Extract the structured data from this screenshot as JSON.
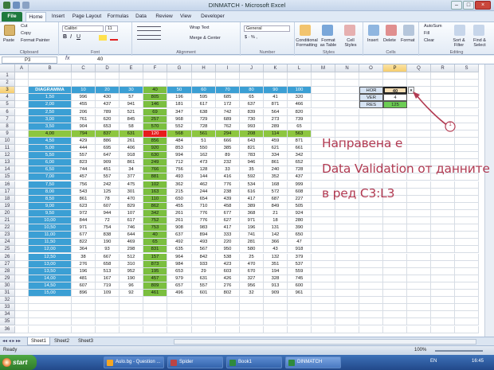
{
  "window": {
    "title": "DINMATCH - Microsoft Excel"
  },
  "tabs": [
    "File",
    "Home",
    "Insert",
    "Page Layout",
    "Formulas",
    "Data",
    "Review",
    "View",
    "Developer"
  ],
  "ribbon": {
    "clipboard": {
      "label": "Clipboard",
      "paste": "Paste",
      "cut": "Cut",
      "copy": "Copy",
      "format_painter": "Format Painter"
    },
    "font": {
      "label": "Font",
      "name": "Calibri",
      "size": "11"
    },
    "alignment": {
      "label": "Alignment",
      "wrap": "Wrap Text",
      "merge": "Merge & Center"
    },
    "number": {
      "label": "Number",
      "format": "General"
    },
    "styles": {
      "label": "Styles",
      "cond": "Conditional Formatting",
      "table": "Format as Table",
      "cell": "Cell Styles"
    },
    "cells": {
      "label": "Cells",
      "insert": "Insert",
      "delete": "Delete",
      "format": "Format"
    },
    "editing": {
      "label": "Editing",
      "autosum": "AutoSum",
      "fill": "Fill",
      "clear": "Clear",
      "sort": "Sort & Filter",
      "find": "Find & Select"
    }
  },
  "formula_bar": {
    "name_box": "P3",
    "fx": "fx",
    "value": "40"
  },
  "columns": [
    "A",
    "B",
    "C",
    "D",
    "E",
    "F",
    "G",
    "H",
    "I",
    "J",
    "K",
    "L",
    "M",
    "N",
    "O",
    "P",
    "Q",
    "R",
    "S"
  ],
  "rows": [
    "1",
    "2",
    "3",
    "4",
    "5",
    "6",
    "7",
    "8",
    "9",
    "10",
    "11",
    "12",
    "13",
    "14",
    "15",
    "16",
    "17",
    "18",
    "19",
    "20",
    "21",
    "22",
    "23",
    "24",
    "25",
    "26",
    "27",
    "28",
    "29",
    "30",
    "31",
    "32",
    "33",
    "34",
    "35",
    "36"
  ],
  "table": {
    "header_label": "DIAGRAMMA",
    "header_values": [
      "10",
      "20",
      "30",
      "40",
      "50",
      "60",
      "70",
      "80",
      "90",
      "100"
    ],
    "rows": [
      [
        "1,50",
        "996",
        "430",
        "57",
        "805",
        "196",
        "595",
        "685",
        "65",
        "41",
        "320"
      ],
      [
        "2,00",
        "455",
        "437",
        "941",
        "146",
        "181",
        "617",
        "172",
        "637",
        "871",
        "466"
      ],
      [
        "2,50",
        "206",
        "789",
        "521",
        "69",
        "347",
        "638",
        "742",
        "839",
        "564",
        "820"
      ],
      [
        "3,00",
        "761",
        "620",
        "845",
        "257",
        "968",
        "729",
        "689",
        "730",
        "273",
        "739"
      ],
      [
        "3,50",
        "904",
        "653",
        "58",
        "570",
        "552",
        "728",
        "762",
        "993",
        "289",
        "65"
      ],
      [
        "4,00",
        "794",
        "837",
        "631",
        "120",
        "568",
        "561",
        "294",
        "208",
        "114",
        "563"
      ],
      [
        "4,50",
        "429",
        "886",
        "261",
        "856",
        "484",
        "51",
        "666",
        "643",
        "459",
        "871"
      ],
      [
        "5,00",
        "444",
        "695",
        "406",
        "920",
        "853",
        "550",
        "385",
        "821",
        "621",
        "661"
      ],
      [
        "5,50",
        "557",
        "647",
        "918",
        "630",
        "994",
        "162",
        "89",
        "783",
        "334",
        "342"
      ],
      [
        "6,00",
        "823",
        "909",
        "861",
        "249",
        "712",
        "473",
        "232",
        "946",
        "861",
        "652"
      ],
      [
        "6,50",
        "744",
        "451",
        "34",
        "766",
        "756",
        "128",
        "33",
        "35",
        "240",
        "728"
      ],
      [
        "7,00",
        "457",
        "557",
        "377",
        "881",
        "493",
        "144",
        "416",
        "592",
        "352",
        "437"
      ],
      [
        "7,50",
        "756",
        "242",
        "475",
        "102",
        "362",
        "462",
        "776",
        "534",
        "168",
        "999"
      ],
      [
        "8,00",
        "543",
        "125",
        "301",
        "163",
        "215",
        "244",
        "238",
        "616",
        "572",
        "608"
      ],
      [
        "8,50",
        "861",
        "78",
        "470",
        "110",
        "650",
        "654",
        "439",
        "417",
        "687",
        "227"
      ],
      [
        "9,00",
        "623",
        "607",
        "829",
        "862",
        "455",
        "710",
        "458",
        "389",
        "849",
        "505"
      ],
      [
        "9,50",
        "972",
        "944",
        "107",
        "342",
        "261",
        "776",
        "677",
        "368",
        "21",
        "924"
      ],
      [
        "10,00",
        "844",
        "72",
        "617",
        "752",
        "261",
        "776",
        "627",
        "971",
        "18",
        "280"
      ],
      [
        "10,50",
        "971",
        "754",
        "746",
        "753",
        "908",
        "983",
        "417",
        "196",
        "131",
        "390"
      ],
      [
        "11,00",
        "677",
        "838",
        "644",
        "40",
        "637",
        "894",
        "333",
        "741",
        "142",
        "650"
      ],
      [
        "11,50",
        "822",
        "190",
        "469",
        "65",
        "492",
        "493",
        "220",
        "281",
        "366",
        "47"
      ],
      [
        "12,00",
        "364",
        "93",
        "298",
        "831",
        "635",
        "567",
        "950",
        "580",
        "43",
        "918"
      ],
      [
        "12,50",
        "38",
        "667",
        "512",
        "157",
        "964",
        "842",
        "538",
        "25",
        "132",
        "379"
      ],
      [
        "13,00",
        "276",
        "658",
        "310",
        "873",
        "984",
        "933",
        "423",
        "470",
        "351",
        "537"
      ],
      [
        "13,50",
        "196",
        "513",
        "952",
        "195",
        "653",
        "29",
        "603",
        "670",
        "194",
        "559"
      ],
      [
        "14,00",
        "481",
        "167",
        "190",
        "457",
        "979",
        "631",
        "426",
        "327",
        "328",
        "745"
      ],
      [
        "14,50",
        "607",
        "719",
        "96",
        "809",
        "657",
        "557",
        "276",
        "956",
        "913",
        "600"
      ],
      [
        "15,00",
        "896",
        "109",
        "92",
        "461",
        "496",
        "601",
        "802",
        "32",
        "909",
        "961"
      ]
    ]
  },
  "lookup": {
    "hor_label": "HOR",
    "hor_value": "40",
    "ver_label": "VER",
    "ver_value": "4",
    "res_label": "RES",
    "res_value": "125"
  },
  "annotation": {
    "line1": "Направена е",
    "line2": "Data Validation  от данните",
    "line3": "в ред C3:L3",
    "callout": "1"
  },
  "sheets": [
    "Sheet1",
    "Sheet2",
    "Sheet3"
  ],
  "status": {
    "ready": "Ready",
    "zoom": "100%"
  },
  "taskbar": {
    "start": "start",
    "items": [
      "Aulo.bg - Question ...",
      "Spider",
      "Book1",
      "DINMATCH"
    ],
    "lang": "EN",
    "time": "16:45"
  },
  "colors": {
    "header_blue": "#3b9fd4",
    "green": "#7bbf3f",
    "highlight_row": "#8dc63f",
    "red": "#e81c1c",
    "lookup_res": "#6ccc54"
  }
}
